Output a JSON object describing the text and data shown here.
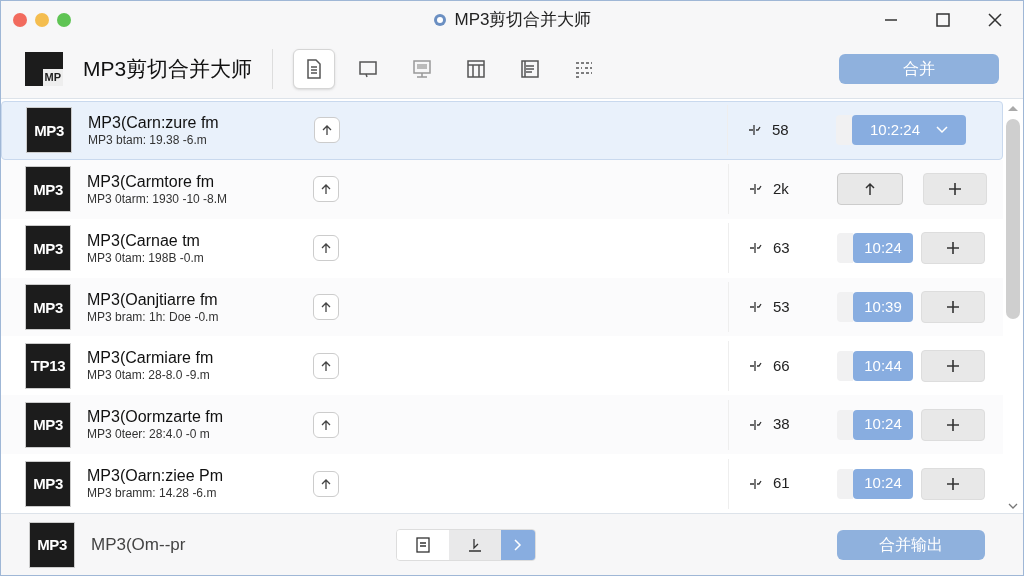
{
  "window": {
    "title": "MP3剪切合并大师"
  },
  "toolbar": {
    "app_name": "MP3剪切合并大师",
    "logo_text": "MP",
    "tools": [
      {
        "selected": true
      },
      {
        "selected": false
      },
      {
        "selected": false
      },
      {
        "selected": false
      },
      {
        "selected": false
      },
      {
        "selected": false
      }
    ],
    "merge_button": "合并"
  },
  "files": [
    {
      "thumb": "MP3",
      "name": "MP3(Carn:zure fm",
      "detail": "MP3 btam: 19.38 -6.m",
      "stat": "58",
      "selected": true,
      "kind": "dropdown",
      "time": "10:2:24"
    },
    {
      "thumb": "MP3",
      "name": "MP3(Carmtore fm",
      "detail": "MP3 0tarm: 1930 -10 -8.M",
      "stat": "2k",
      "selected": false,
      "kind": "buttons"
    },
    {
      "thumb": "MP3",
      "name": "MP3(Carnae tm",
      "detail": "MP3 0tam: 198B -0.m",
      "stat": "63",
      "selected": false,
      "kind": "time",
      "time": "10:24"
    },
    {
      "thumb": "MP3",
      "name": "MP3(Oanjtiarre fm",
      "detail": "MP3 bram: 1h: Doe -0.m",
      "stat": "53",
      "selected": false,
      "kind": "time",
      "time": "10:39"
    },
    {
      "thumb": "TP13",
      "name": "MP3(Carmiare fm",
      "detail": "MP3 0tam: 28-8.0 -9.m",
      "stat": "66",
      "selected": false,
      "kind": "time",
      "time": "10:44"
    },
    {
      "thumb": "MP3",
      "name": "MP3(Oormzarte fm",
      "detail": "MP3 0teer: 28:4.0 -0 m",
      "stat": "38",
      "selected": false,
      "kind": "time",
      "time": "10:24"
    },
    {
      "thumb": "MP3",
      "name": "MP3(Oarn:ziee Pm",
      "detail": "MP3 bramm: 14.28 -6.m",
      "stat": "61",
      "selected": false,
      "kind": "time",
      "time": "10:24"
    }
  ],
  "footer": {
    "thumb": "MP3",
    "name": "MP3(Om--pr",
    "segments": [
      {
        "selected": false
      },
      {
        "selected": false
      },
      {
        "selected": true
      }
    ],
    "export_button": "合并输出"
  }
}
